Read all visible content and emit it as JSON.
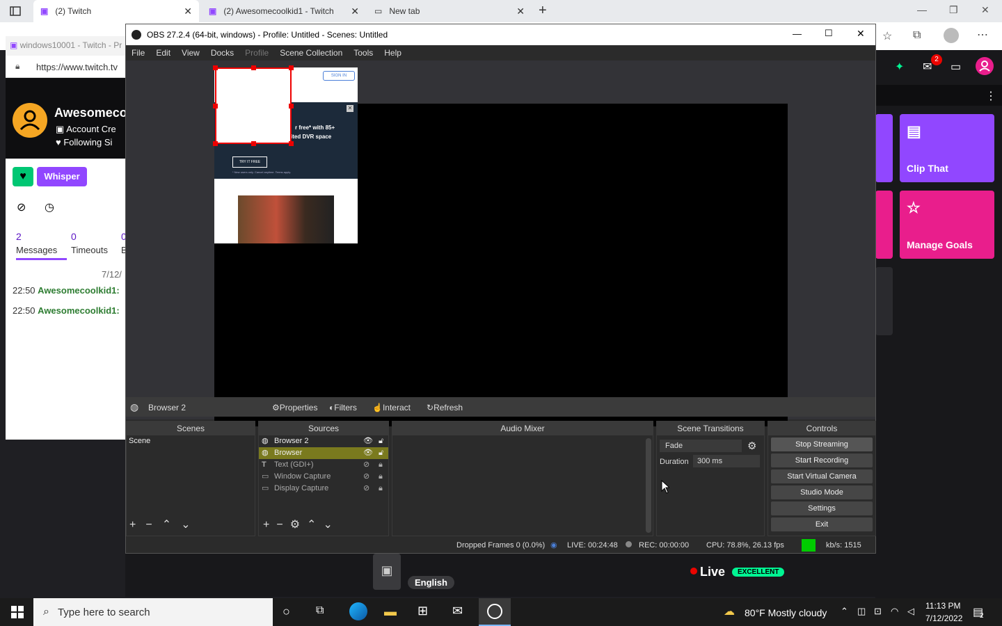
{
  "browser": {
    "tabs": [
      {
        "label": "(2) Twitch"
      },
      {
        "label": "(2) Awesomecoolkid1 - Twitch"
      },
      {
        "label": "New tab"
      }
    ],
    "url": "https://www.twitch.tv",
    "window2_tab": "windows10001 - Twitch - Pr"
  },
  "twitch": {
    "username": "Awesomeco",
    "account_line": "Account Cre",
    "following_line": "Following Si",
    "whisper": "Whisper",
    "stats": [
      {
        "num": "2",
        "label": "Messages"
      },
      {
        "num": "0",
        "label": "Timeouts"
      },
      {
        "num": "0",
        "label": "B"
      }
    ],
    "date": "7/12/",
    "messages": [
      {
        "time": "22:50",
        "user": "Awesomecoolkid1:"
      },
      {
        "time": "22:50",
        "user": "Awesomecoolkid1:"
      }
    ],
    "notif_count": "2",
    "tiles": [
      {
        "label": "Clip That"
      },
      {
        "label": "Manage Goals"
      }
    ],
    "live_label": "Live",
    "quality_badge": "EXCELLENT",
    "language": "English"
  },
  "obs": {
    "title": "OBS 27.2.4 (64-bit, windows) - Profile: Untitled - Scenes: Untitled",
    "menu": [
      "File",
      "Edit",
      "View",
      "Docks",
      "Profile",
      "Scene Collection",
      "Tools",
      "Help"
    ],
    "preview_ad": {
      "signin": "SIGN IN",
      "headline1": "r free* with 85+",
      "headline2": "ited DVR space",
      "cta": "TRY IT FREE",
      "fine": "* New users only. Cancel anytime. Terms apply."
    },
    "selected_source": "Browser 2",
    "source_toolbar": [
      "Properties",
      "Filters",
      "Interact",
      "Refresh"
    ],
    "docks": {
      "scenes": "Scenes",
      "sources": "Sources",
      "mixer": "Audio Mixer",
      "transitions": "Scene Transitions",
      "controls": "Controls"
    },
    "scenes": [
      "Scene"
    ],
    "sources": [
      {
        "name": "Browser 2",
        "icon": "globe-icon",
        "active": true
      },
      {
        "name": "Browser",
        "icon": "globe-icon",
        "active": true
      },
      {
        "name": "Text (GDI+)",
        "icon": "text-icon",
        "active": false
      },
      {
        "name": "Window Capture",
        "icon": "window-icon",
        "active": false
      },
      {
        "name": "Display Capture",
        "icon": "monitor-icon",
        "active": false
      }
    ],
    "transition": {
      "type": "Fade",
      "duration_label": "Duration",
      "duration": "300 ms"
    },
    "controls": [
      "Stop Streaming",
      "Start Recording",
      "Start Virtual Camera",
      "Studio Mode",
      "Settings",
      "Exit"
    ],
    "status": {
      "dropped": "Dropped Frames 0 (0.0%)",
      "live": "LIVE: 00:24:48",
      "rec": "REC: 00:00:00",
      "cpu": "CPU: 78.8%, 26.13 fps",
      "kbps": "kb/s: 1515"
    }
  },
  "taskbar": {
    "search_placeholder": "Type here to search",
    "weather": "80°F  Mostly cloudy",
    "time": "11:13 PM",
    "date": "7/12/2022",
    "notif": "2"
  },
  "colors": {
    "twitch_purple": "#9147ff",
    "magenta": "#e91e8c",
    "live_green": "#00f593",
    "obs_highlight": "#7a7a1e"
  }
}
